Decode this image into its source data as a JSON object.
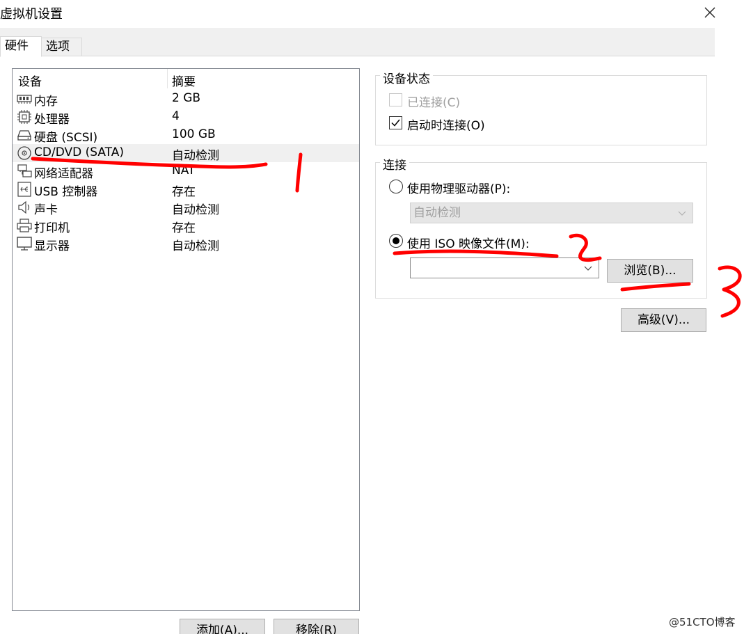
{
  "window": {
    "title": "虚拟机设置"
  },
  "tabs": {
    "hardware": "硬件",
    "options": "选项"
  },
  "device_list": {
    "col_device": "设备",
    "col_summary": "摘要",
    "rows": [
      {
        "name": "内存",
        "summary": "2 GB",
        "icon": "memory-icon"
      },
      {
        "name": "处理器",
        "summary": "4",
        "icon": "processor-icon"
      },
      {
        "name": "硬盘 (SCSI)",
        "summary": "100 GB",
        "icon": "hard-disk-icon"
      },
      {
        "name": "CD/DVD (SATA)",
        "summary": "自动检测",
        "icon": "cd-dvd-icon",
        "selected": true
      },
      {
        "name": "网络适配器",
        "summary": "NAT",
        "icon": "network-adapter-icon"
      },
      {
        "name": "USB 控制器",
        "summary": "存在",
        "icon": "usb-icon"
      },
      {
        "name": "声卡",
        "summary": "自动检测",
        "icon": "speaker-icon"
      },
      {
        "name": "打印机",
        "summary": "存在",
        "icon": "printer-icon"
      },
      {
        "name": "显示器",
        "summary": "自动检测",
        "icon": "monitor-icon"
      }
    ]
  },
  "buttons": {
    "add": "添加(A)...",
    "remove": "移除(R)",
    "browse": "浏览(B)...",
    "advanced": "高级(V)..."
  },
  "device_status": {
    "title": "设备状态",
    "connected_label": "已连接(C)",
    "connected_checked": false,
    "connected_enabled": false,
    "startup_label": "启动时连接(O)",
    "startup_checked": true
  },
  "connection": {
    "title": "连接",
    "physical_label": "使用物理驱动器(P):",
    "physical_selected": false,
    "physical_drive_value": "自动检测",
    "iso_label": "使用 ISO 映像文件(M):",
    "iso_selected": true,
    "iso_path_value": ""
  },
  "annotations": {
    "marker_color": "#ff0000",
    "numbers": [
      "1",
      "2",
      "3"
    ]
  },
  "watermark": "@51CTO博客"
}
